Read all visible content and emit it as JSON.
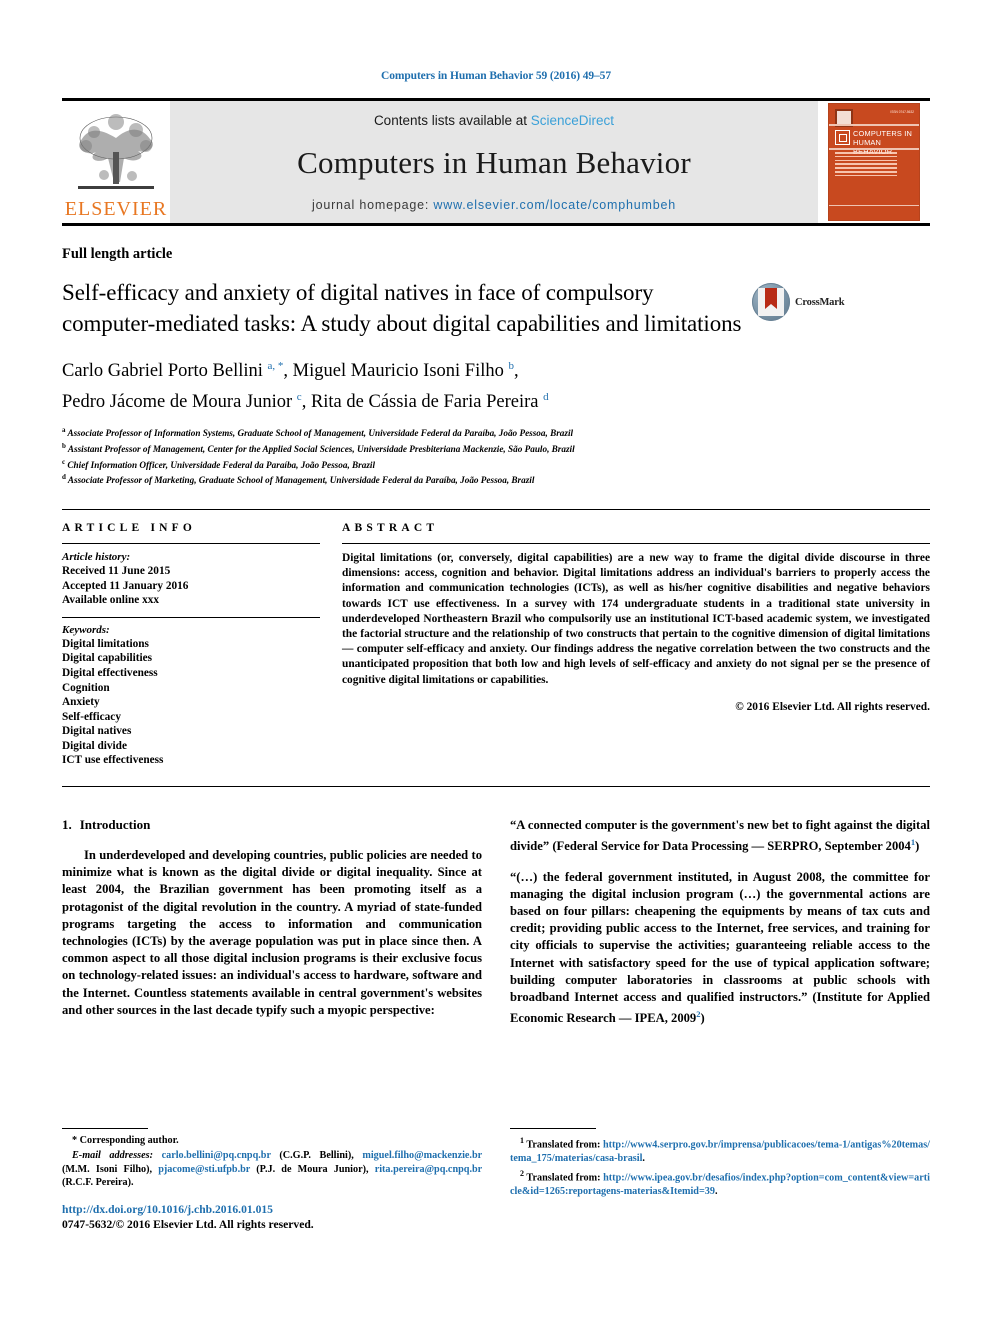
{
  "running_head": "Computers in Human Behavior 59 (2016) 49–57",
  "masthead": {
    "contents_prefix": "Contents lists available at ",
    "sciencedirect": "ScienceDirect",
    "journal_title": "Computers in Human Behavior",
    "homepage_label": "journal homepage: ",
    "homepage_url": "www.elsevier.com/locate/comphumbeh",
    "publisher_name": "ELSEVIER",
    "cover": {
      "title_line1": "COMPUTERS IN",
      "title_line2": "HUMAN BEHAVIOR"
    },
    "accent_orange": "#e87722",
    "accent_blue": "#1f6fae",
    "cover_color": "#c8491f"
  },
  "article": {
    "type": "Full length article",
    "title": "Self-efficacy and anxiety of digital natives in face of compulsory computer-mediated tasks: A study about digital capabilities and limitations",
    "crossmark_label": "CrossMark",
    "authors_line1_a": "Carlo Gabriel Porto Bellini ",
    "authors_line1_sup_a": "a, *",
    "authors_line1_b": ", Miguel Mauricio Isoni Filho ",
    "authors_line1_sup_b": "b",
    "authors_line1_end": ",",
    "authors_line2_a": "Pedro Jácome de Moura Junior ",
    "authors_line2_sup_c": "c",
    "authors_line2_b": ", Rita de Cássia de Faria Pereira ",
    "authors_line2_sup_d": "d",
    "affiliations": [
      {
        "mark": "a",
        "text": "Associate Professor of Information Systems, Graduate School of Management, Universidade Federal da Paraíba, João Pessoa, Brazil"
      },
      {
        "mark": "b",
        "text": "Assistant Professor of Management, Center for the Applied Social Sciences, Universidade Presbiteriana Mackenzie, São Paulo, Brazil"
      },
      {
        "mark": "c",
        "text": "Chief Information Officer, Universidade Federal da Paraíba, João Pessoa, Brazil"
      },
      {
        "mark": "d",
        "text": "Associate Professor of Marketing, Graduate School of Management, Universidade Federal da Paraíba, João Pessoa, Brazil"
      }
    ]
  },
  "article_info": {
    "label": "ARTICLE INFO",
    "history_title": "Article history:",
    "history": [
      "Received 11 June 2015",
      "Accepted 11 January 2016",
      "Available online xxx"
    ],
    "keywords_title": "Keywords:",
    "keywords": [
      "Digital limitations",
      "Digital capabilities",
      "Digital effectiveness",
      "Cognition",
      "Anxiety",
      "Self-efficacy",
      "Digital natives",
      "Digital divide",
      "ICT use effectiveness"
    ]
  },
  "abstract": {
    "label": "ABSTRACT",
    "text": "Digital limitations (or, conversely, digital capabilities) are a new way to frame the digital divide discourse in three dimensions: access, cognition and behavior. Digital limitations address an individual's barriers to properly access the information and communication technologies (ICTs), as well as his/her cognitive disabilities and negative behaviors towards ICT use effectiveness. In a survey with 174 undergraduate students in a traditional state university in underdeveloped Northeastern Brazil who compulsorily use an institutional ICT-based academic system, we investigated the factorial structure and the relationship of two constructs that pertain to the cognitive dimension of digital limitations — computer self-efficacy and anxiety. Our findings address the negative correlation between the two constructs and the unanticipated proposition that both low and high levels of self-efficacy and anxiety do not signal per se the presence of cognitive digital limitations or capabilities.",
    "copyright": "© 2016 Elsevier Ltd. All rights reserved."
  },
  "introduction": {
    "number": "1.",
    "heading": "Introduction",
    "paragraph1": "In underdeveloped and developing countries, public policies are needed to minimize what is known as the digital divide or digital inequality. Since at least 2004, the Brazilian government has been promoting itself as a protagonist of the digital revolution in the country. A myriad of state-funded programs targeting the access to information and communication technologies (ICTs) by the average population was put in place since then. A common aspect to all those digital inclusion programs is their exclusive focus on technology-related issues: an individual's access to hardware, software and the Internet. Countless statements available in central government's websites and other sources in the last decade typify such a myopic perspective:",
    "quote1": "“A connected computer is the government's new bet to fight against the digital divide” (Federal Service for Data Processing — SERPRO, September 2004",
    "quote1_sup": "1",
    "quote1_end": ")",
    "quote2": "“(…) the federal government instituted, in August 2008, the committee for managing the digital inclusion program (…) the governmental actions are based on four pillars: cheapening the equipments by means of tax cuts and credit; providing public access to the Internet, free services, and training for city officials to supervise the activities; guaranteeing reliable access to the Internet with satisfactory speed for the use of typical application software; building computer laboratories in classrooms at public schools with broadband Internet access and qualified instructors.” (Institute for Applied Economic Research — IPEA, 2009",
    "quote2_sup": "2",
    "quote2_end": ")"
  },
  "footnotes": {
    "corresponding": "* Corresponding author.",
    "email_label": "E-mail addresses:",
    "emails": [
      {
        "address": "carlo.bellini@pq.cnpq.br",
        "owner": " (C.G.P. Bellini), "
      },
      {
        "address": "miguel.filho@mackenzie.br",
        "owner": " (M.M. Isoni Filho), "
      },
      {
        "address": "pjacome@sti.ufpb.br",
        "owner": " (P.J. de Moura Junior), "
      },
      {
        "address": "rita.pereira@pq.cnpq.br",
        "owner": " (R.C.F. Pereira)."
      }
    ],
    "note1_mark": "1",
    "note1_label": "Translated from: ",
    "note1_url": "http://www4.serpro.gov.br/imprensa/publicacoes/tema-1/antigas%20temas/tema_175/materias/casa-brasil",
    "note1_end": ".",
    "note2_mark": "2",
    "note2_label": "Translated from: ",
    "note2_url": "http://www.ipea.gov.br/desafios/index.php?option=com_content&view=article&id=1265:reportagens-materias&Itemid=39",
    "note2_end": "."
  },
  "doi_block": {
    "doi": "http://dx.doi.org/10.1016/j.chb.2016.01.015",
    "issn_copyright": "0747-5632/© 2016 Elsevier Ltd. All rights reserved."
  }
}
